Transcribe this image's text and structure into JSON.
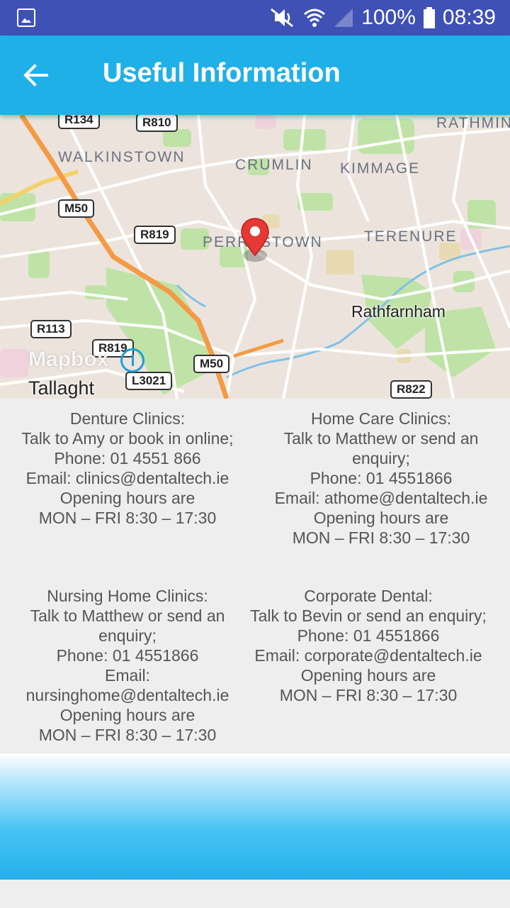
{
  "status_bar": {
    "battery": "100%",
    "time": "08:39"
  },
  "app_bar": {
    "title": "Useful Information"
  },
  "map": {
    "labels": {
      "walkinstown": "WALKINSTOWN",
      "crumlin": "CRUMLIN",
      "kimmage": "KIMMAGE",
      "rathmines": "RATHMIN",
      "perrystown": "PERRYSTOWN",
      "terenure": "TERENURE",
      "rathfarnham": "Rathfarnham",
      "tallaght": "Tallaght",
      "attribution": "Mapbox"
    },
    "road_shields": {
      "r134": "R134",
      "r810": "R810",
      "m50_top": "M50",
      "r819_top": "R819",
      "r113": "R113",
      "r819_bottom": "R819",
      "l3021": "L3021",
      "m50_bottom": "M50",
      "r822": "R822"
    }
  },
  "clinics": [
    {
      "title": "Denture Clinics:",
      "contact": "Talk to Amy or book in online;",
      "phone": "Phone: 01 4551 866",
      "email": "Email: clinics@dentaltech.ie",
      "hours_label": "Opening hours are",
      "hours": "MON – FRI 8:30 – 17:30"
    },
    {
      "title": "Home Care Clinics:",
      "contact": "Talk to Matthew or send an enquiry;",
      "phone": "Phone: 01 4551866",
      "email": "Email: athome@dentaltech.ie",
      "hours_label": "Opening hours are",
      "hours": "MON – FRI 8:30 – 17:30"
    },
    {
      "title": "Nursing Home Clinics:",
      "contact": "Talk to Matthew or send an enquiry;",
      "phone": "Phone: 01 4551866",
      "email_label": "Email:",
      "email": "nursinghome@dentaltech.ie",
      "hours_label": "Opening hours are",
      "hours": "MON – FRI 8:30 – 17:30"
    },
    {
      "title": "Corporate Dental:",
      "contact": "Talk to Bevin or send an enquiry;",
      "phone": "Phone: 01 4551866",
      "email": "Email: corporate@dentaltech.ie",
      "hours_label": "Opening hours are",
      "hours": "MON – FRI 8:30 – 17:30"
    }
  ]
}
